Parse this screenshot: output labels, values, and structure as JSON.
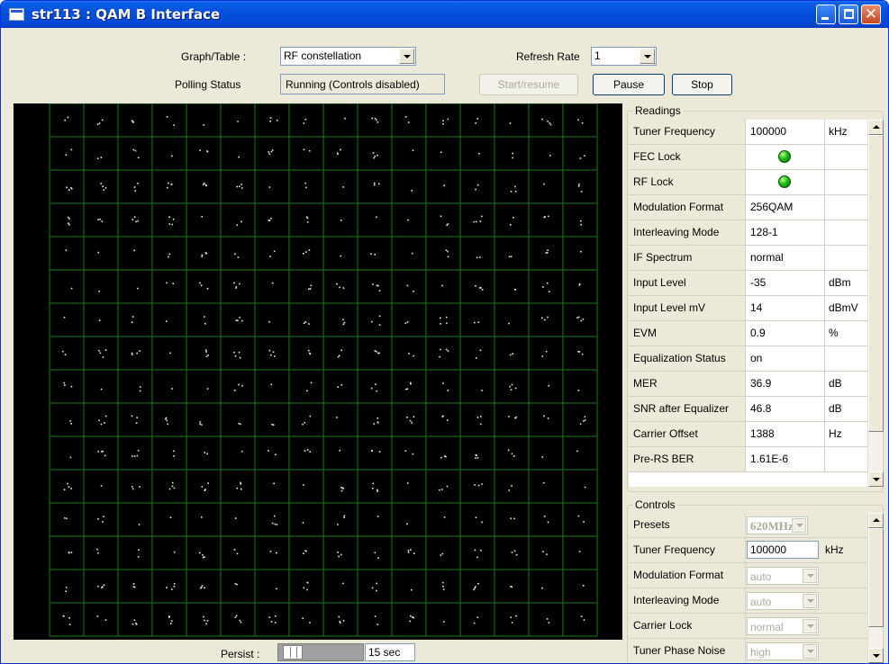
{
  "window": {
    "title": "str113 : QAM B Interface"
  },
  "toolbar": {
    "graph_table_label": "Graph/Table :",
    "graph_table_value": "RF constellation",
    "refresh_label": "Refresh Rate",
    "refresh_value": "1",
    "polling_label": "Polling Status",
    "polling_value": "Running (Controls disabled)",
    "start_label": "Start/resume",
    "pause_label": "Pause",
    "stop_label": "Stop"
  },
  "graph": {
    "type": "constellation",
    "grid_lines": 16,
    "background": "#000000",
    "grid_color": "#1e7a1e"
  },
  "persist": {
    "label": "Persist :",
    "value": "15 sec"
  },
  "readings": {
    "title": "Readings",
    "rows": [
      {
        "name": "Tuner Frequency",
        "value": "100000",
        "unit": "kHz"
      },
      {
        "name": "FEC Lock",
        "value": "",
        "unit": "",
        "led": "green"
      },
      {
        "name": "RF Lock",
        "value": "",
        "unit": "",
        "led": "green"
      },
      {
        "name": "Modulation Format",
        "value": "256QAM",
        "unit": ""
      },
      {
        "name": "Interleaving Mode",
        "value": "128-1",
        "unit": ""
      },
      {
        "name": "IF Spectrum",
        "value": "normal",
        "unit": ""
      },
      {
        "name": "Input Level",
        "value": "-35",
        "unit": "dBm"
      },
      {
        "name": "Input Level mV",
        "value": "14",
        "unit": "dBmV"
      },
      {
        "name": "EVM",
        "value": "0.9",
        "unit": "%"
      },
      {
        "name": "Equalization Status",
        "value": "on",
        "unit": ""
      },
      {
        "name": "MER",
        "value": "36.9",
        "unit": "dB"
      },
      {
        "name": "SNR after Equalizer",
        "value": "46.8",
        "unit": "dB"
      },
      {
        "name": "Carrier Offset",
        "value": "1388",
        "unit": "Hz"
      },
      {
        "name": "Pre-RS BER",
        "value": "1.61E-6",
        "unit": ""
      }
    ]
  },
  "controls": {
    "title": "Controls",
    "rows": [
      {
        "name": "Presets",
        "value": "620MHz",
        "kind": "combo-bold"
      },
      {
        "name": "Tuner Frequency",
        "value": "100000",
        "unit": "kHz",
        "kind": "input"
      },
      {
        "name": "Modulation Format",
        "value": "auto",
        "kind": "combo"
      },
      {
        "name": "Interleaving Mode",
        "value": "auto",
        "kind": "combo"
      },
      {
        "name": "Carrier Lock",
        "value": "normal",
        "kind": "combo"
      },
      {
        "name": "Tuner Phase Noise",
        "value": "high",
        "kind": "combo"
      }
    ]
  }
}
